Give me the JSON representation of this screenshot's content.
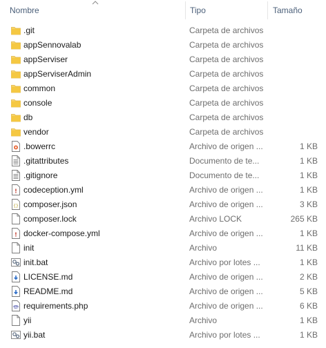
{
  "columns": {
    "name": "Nombre",
    "type": "Tipo",
    "size": "Tamaño"
  },
  "colors": {
    "header_text": "#4c607a",
    "folder": "#f5c842",
    "secondary_text": "#6d6d6d"
  },
  "files": [
    {
      "name": ".git",
      "type": "Carpeta de archivos",
      "size": "",
      "icon": "folder-icon"
    },
    {
      "name": "appSennovalab",
      "type": "Carpeta de archivos",
      "size": "",
      "icon": "folder-icon"
    },
    {
      "name": "appServiser",
      "type": "Carpeta de archivos",
      "size": "",
      "icon": "folder-icon"
    },
    {
      "name": "appServiserAdmin",
      "type": "Carpeta de archivos",
      "size": "",
      "icon": "folder-icon"
    },
    {
      "name": "common",
      "type": "Carpeta de archivos",
      "size": "",
      "icon": "folder-icon"
    },
    {
      "name": "console",
      "type": "Carpeta de archivos",
      "size": "",
      "icon": "folder-icon"
    },
    {
      "name": "db",
      "type": "Carpeta de archivos",
      "size": "",
      "icon": "folder-icon"
    },
    {
      "name": "vendor",
      "type": "Carpeta de archivos",
      "size": "",
      "icon": "folder-icon"
    },
    {
      "name": ".bowerrc",
      "type": "Archivo de origen ...",
      "size": "1 KB",
      "icon": "source-file-icon"
    },
    {
      "name": ".gitattributes",
      "type": "Documento de te...",
      "size": "1 KB",
      "icon": "text-document-icon"
    },
    {
      "name": ".gitignore",
      "type": "Documento de te...",
      "size": "1 KB",
      "icon": "text-document-icon"
    },
    {
      "name": "codeception.yml",
      "type": "Archivo de origen ...",
      "size": "1 KB",
      "icon": "yml-file-icon"
    },
    {
      "name": "composer.json",
      "type": "Archivo de origen ...",
      "size": "3 KB",
      "icon": "json-file-icon"
    },
    {
      "name": "composer.lock",
      "type": "Archivo LOCK",
      "size": "265 KB",
      "icon": "blank-file-icon"
    },
    {
      "name": "docker-compose.yml",
      "type": "Archivo de origen ...",
      "size": "1 KB",
      "icon": "yml-file-icon"
    },
    {
      "name": "init",
      "type": "Archivo",
      "size": "11 KB",
      "icon": "blank-file-icon"
    },
    {
      "name": "init.bat",
      "type": "Archivo por lotes ...",
      "size": "1 KB",
      "icon": "batch-file-icon"
    },
    {
      "name": "LICENSE.md",
      "type": "Archivo de origen ...",
      "size": "2 KB",
      "icon": "markdown-file-icon"
    },
    {
      "name": "README.md",
      "type": "Archivo de origen ...",
      "size": "5 KB",
      "icon": "markdown-file-icon"
    },
    {
      "name": "requirements.php",
      "type": "Archivo de origen ...",
      "size": "6 KB",
      "icon": "php-file-icon"
    },
    {
      "name": "yii",
      "type": "Archivo",
      "size": "1 KB",
      "icon": "blank-file-icon"
    },
    {
      "name": "yii.bat",
      "type": "Archivo por lotes ...",
      "size": "1 KB",
      "icon": "batch-file-icon"
    }
  ]
}
